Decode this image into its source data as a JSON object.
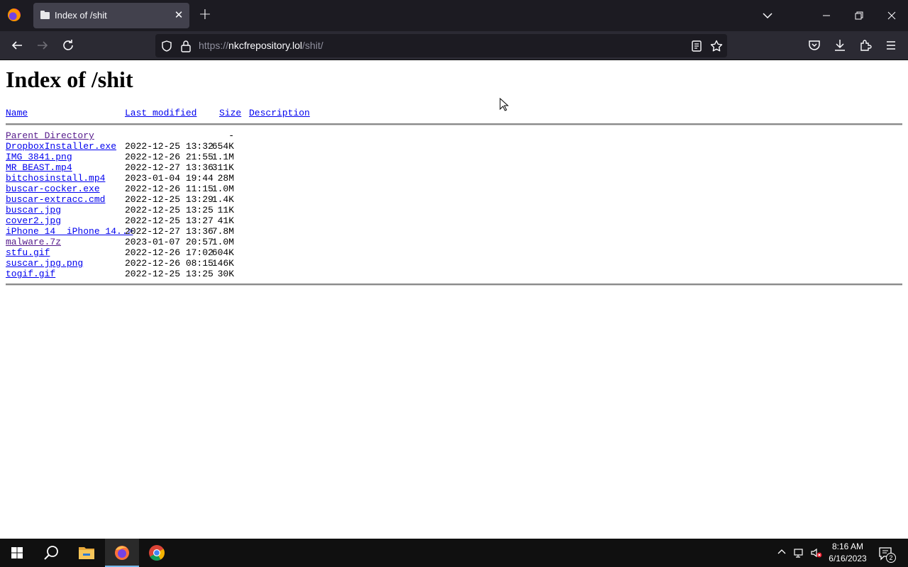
{
  "browser": {
    "tab": {
      "title": "Index of /shit",
      "close_glyph": "✕",
      "icon": "folder-icon"
    },
    "new_tab_glyph": "+",
    "url": {
      "scheme": "https://",
      "host": "nkcfrepository.lol",
      "path": "/shit/"
    }
  },
  "page": {
    "title": "Index of /shit",
    "columns": {
      "name": "Name",
      "last_modified": "Last modified",
      "size": "Size",
      "description": "Description"
    },
    "parent": {
      "name": "Parent Directory",
      "size": "-"
    },
    "files": [
      {
        "name": "DropboxInstaller.exe",
        "modified": "2022-12-25 13:32",
        "size": "654K",
        "visited": false
      },
      {
        "name": "IMG_3841.png",
        "modified": "2022-12-26 21:55",
        "size": "1.1M",
        "visited": false
      },
      {
        "name": "MR_BEAST.mp4",
        "modified": "2022-12-27 13:36",
        "size": "311K",
        "visited": false
      },
      {
        "name": "bitchosinstall.mp4",
        "modified": "2023-01-04 19:44",
        "size": "28M",
        "visited": false
      },
      {
        "name": "buscar-cocker.exe",
        "modified": "2022-12-26 11:15",
        "size": "1.0M",
        "visited": false
      },
      {
        "name": "buscar-extracc.cmd",
        "modified": "2022-12-25 13:29",
        "size": "1.4K",
        "visited": false
      },
      {
        "name": "buscar.jpg",
        "modified": "2022-12-25 13:25",
        "size": "11K",
        "visited": false
      },
      {
        "name": "cover2.jpg",
        "modified": "2022-12-25 13:27",
        "size": "41K",
        "visited": false
      },
      {
        "name": "iPhone_14__iPhone_14..>",
        "modified": "2022-12-27 13:36",
        "size": "7.8M",
        "visited": false
      },
      {
        "name": "malware.7z",
        "modified": "2023-01-07 20:57",
        "size": "1.0M",
        "visited": true
      },
      {
        "name": "stfu.gif",
        "modified": "2022-12-26 17:02",
        "size": "604K",
        "visited": false
      },
      {
        "name": "suscar.jpg.png",
        "modified": "2022-12-26 08:15",
        "size": "146K",
        "visited": false
      },
      {
        "name": "togif.gif",
        "modified": "2022-12-25 13:25",
        "size": "30K",
        "visited": false
      }
    ]
  },
  "taskbar": {
    "time": "8:16 AM",
    "date": "6/16/2023",
    "notification_count": "2",
    "pinned": [
      "start-icon",
      "search-icon",
      "file-explorer-icon",
      "firefox-icon",
      "chrome-icon"
    ]
  },
  "colors": {
    "link": "#0000ee",
    "visited_link": "#551a8b",
    "titlebar": "#1c1b22",
    "toolbar": "#2b2a33",
    "taskbar": "#101010"
  }
}
